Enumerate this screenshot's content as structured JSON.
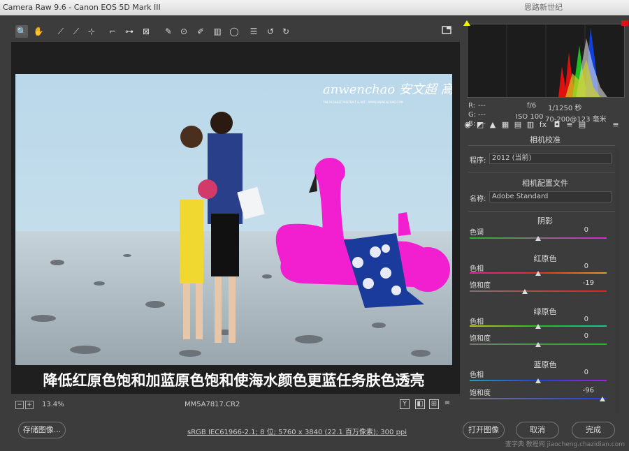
{
  "window": {
    "title": "Camera Raw 9.6 - Canon EOS 5D Mark III",
    "right_text": "思路新世纪"
  },
  "toolbar": {
    "tools": [
      "zoom-tool",
      "hand-tool",
      "white-balance-tool",
      "color-sampler-tool",
      "targeted-adjustment-tool",
      "crop-tool",
      "straighten-tool",
      "transform-tool",
      "spot-removal-tool",
      "red-eye-tool",
      "adjustment-brush-tool",
      "graduated-filter-tool",
      "radial-filter-tool",
      "preferences",
      "rotate-ccw",
      "rotate-cw"
    ],
    "icons": [
      "🔍",
      "✋",
      "⟋",
      "⟋",
      "⊹",
      "⌐",
      "⊶",
      "⊠",
      "✎",
      "⊙",
      "✐",
      "▥",
      "◯",
      "☰",
      "↺",
      "↻"
    ]
  },
  "photo": {
    "watermark": "anwenchao 安文超 高端修图",
    "watermark_sub": "THE HIGHEST PORTRAIT & ART · WWW.ANWENCHAO.COM"
  },
  "caption": "降低红原色饱和加蓝原色饱和使海水颜色更蓝任务肤色透亮",
  "statusbar": {
    "zoom": "13.4%",
    "filename": "MM5A7817.CR2",
    "icons": [
      "Y",
      "◧",
      "⊞",
      "≡"
    ]
  },
  "bottom": {
    "save_label": "存储图像...",
    "info_text": "sRGB IEC61966-2.1; 8 位; 5760 x 3840 (22.1 百万像素); 300 ppi",
    "open_label": "打开图像",
    "cancel_label": "取消",
    "done_label": "完成"
  },
  "histogram": {
    "r_label": "R:",
    "g_label": "G:",
    "b_label": "B:",
    "r_value": "---",
    "g_value": "---",
    "b_value": "---",
    "aperture": "f/6",
    "shutter": "1/1250 秒",
    "iso": "ISO 100",
    "lens": "70-200@123 毫米"
  },
  "panel": {
    "title": "相机校准",
    "process_label": "程序:",
    "process_value": "2012 (当前)",
    "profile_section": "相机配置文件",
    "name_label": "名称:",
    "name_value": "Adobe Standard",
    "shadows_title": "阴影",
    "tint_label": "色调",
    "tint_value": "0",
    "red_title": "红原色",
    "red_hue_label": "色相",
    "red_hue_value": "0",
    "red_sat_label": "饱和度",
    "red_sat_value": "-19",
    "green_title": "绿原色",
    "green_hue_label": "色相",
    "green_hue_value": "0",
    "green_sat_label": "饱和度",
    "green_sat_value": "0",
    "blue_title": "蓝原色",
    "blue_hue_label": "色相",
    "blue_hue_value": "0",
    "blue_sat_label": "饱和度",
    "blue_sat_value": "-96"
  },
  "site_watermark": "查字典 教程网 jiaocheng.chazidian.com",
  "colors": {
    "accent": "#f4f400",
    "red_clip": "#e01010"
  }
}
